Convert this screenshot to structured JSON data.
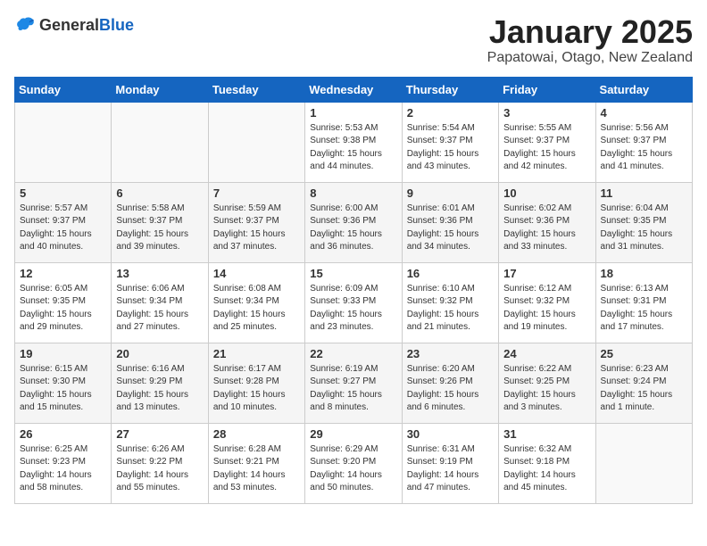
{
  "logo": {
    "general": "General",
    "blue": "Blue"
  },
  "title": "January 2025",
  "location": "Papatowai, Otago, New Zealand",
  "weekdays": [
    "Sunday",
    "Monday",
    "Tuesday",
    "Wednesday",
    "Thursday",
    "Friday",
    "Saturday"
  ],
  "weeks": [
    [
      {
        "day": "",
        "info": ""
      },
      {
        "day": "",
        "info": ""
      },
      {
        "day": "",
        "info": ""
      },
      {
        "day": "1",
        "info": "Sunrise: 5:53 AM\nSunset: 9:38 PM\nDaylight: 15 hours\nand 44 minutes."
      },
      {
        "day": "2",
        "info": "Sunrise: 5:54 AM\nSunset: 9:37 PM\nDaylight: 15 hours\nand 43 minutes."
      },
      {
        "day": "3",
        "info": "Sunrise: 5:55 AM\nSunset: 9:37 PM\nDaylight: 15 hours\nand 42 minutes."
      },
      {
        "day": "4",
        "info": "Sunrise: 5:56 AM\nSunset: 9:37 PM\nDaylight: 15 hours\nand 41 minutes."
      }
    ],
    [
      {
        "day": "5",
        "info": "Sunrise: 5:57 AM\nSunset: 9:37 PM\nDaylight: 15 hours\nand 40 minutes."
      },
      {
        "day": "6",
        "info": "Sunrise: 5:58 AM\nSunset: 9:37 PM\nDaylight: 15 hours\nand 39 minutes."
      },
      {
        "day": "7",
        "info": "Sunrise: 5:59 AM\nSunset: 9:37 PM\nDaylight: 15 hours\nand 37 minutes."
      },
      {
        "day": "8",
        "info": "Sunrise: 6:00 AM\nSunset: 9:36 PM\nDaylight: 15 hours\nand 36 minutes."
      },
      {
        "day": "9",
        "info": "Sunrise: 6:01 AM\nSunset: 9:36 PM\nDaylight: 15 hours\nand 34 minutes."
      },
      {
        "day": "10",
        "info": "Sunrise: 6:02 AM\nSunset: 9:36 PM\nDaylight: 15 hours\nand 33 minutes."
      },
      {
        "day": "11",
        "info": "Sunrise: 6:04 AM\nSunset: 9:35 PM\nDaylight: 15 hours\nand 31 minutes."
      }
    ],
    [
      {
        "day": "12",
        "info": "Sunrise: 6:05 AM\nSunset: 9:35 PM\nDaylight: 15 hours\nand 29 minutes."
      },
      {
        "day": "13",
        "info": "Sunrise: 6:06 AM\nSunset: 9:34 PM\nDaylight: 15 hours\nand 27 minutes."
      },
      {
        "day": "14",
        "info": "Sunrise: 6:08 AM\nSunset: 9:34 PM\nDaylight: 15 hours\nand 25 minutes."
      },
      {
        "day": "15",
        "info": "Sunrise: 6:09 AM\nSunset: 9:33 PM\nDaylight: 15 hours\nand 23 minutes."
      },
      {
        "day": "16",
        "info": "Sunrise: 6:10 AM\nSunset: 9:32 PM\nDaylight: 15 hours\nand 21 minutes."
      },
      {
        "day": "17",
        "info": "Sunrise: 6:12 AM\nSunset: 9:32 PM\nDaylight: 15 hours\nand 19 minutes."
      },
      {
        "day": "18",
        "info": "Sunrise: 6:13 AM\nSunset: 9:31 PM\nDaylight: 15 hours\nand 17 minutes."
      }
    ],
    [
      {
        "day": "19",
        "info": "Sunrise: 6:15 AM\nSunset: 9:30 PM\nDaylight: 15 hours\nand 15 minutes."
      },
      {
        "day": "20",
        "info": "Sunrise: 6:16 AM\nSunset: 9:29 PM\nDaylight: 15 hours\nand 13 minutes."
      },
      {
        "day": "21",
        "info": "Sunrise: 6:17 AM\nSunset: 9:28 PM\nDaylight: 15 hours\nand 10 minutes."
      },
      {
        "day": "22",
        "info": "Sunrise: 6:19 AM\nSunset: 9:27 PM\nDaylight: 15 hours\nand 8 minutes."
      },
      {
        "day": "23",
        "info": "Sunrise: 6:20 AM\nSunset: 9:26 PM\nDaylight: 15 hours\nand 6 minutes."
      },
      {
        "day": "24",
        "info": "Sunrise: 6:22 AM\nSunset: 9:25 PM\nDaylight: 15 hours\nand 3 minutes."
      },
      {
        "day": "25",
        "info": "Sunrise: 6:23 AM\nSunset: 9:24 PM\nDaylight: 15 hours\nand 1 minute."
      }
    ],
    [
      {
        "day": "26",
        "info": "Sunrise: 6:25 AM\nSunset: 9:23 PM\nDaylight: 14 hours\nand 58 minutes."
      },
      {
        "day": "27",
        "info": "Sunrise: 6:26 AM\nSunset: 9:22 PM\nDaylight: 14 hours\nand 55 minutes."
      },
      {
        "day": "28",
        "info": "Sunrise: 6:28 AM\nSunset: 9:21 PM\nDaylight: 14 hours\nand 53 minutes."
      },
      {
        "day": "29",
        "info": "Sunrise: 6:29 AM\nSunset: 9:20 PM\nDaylight: 14 hours\nand 50 minutes."
      },
      {
        "day": "30",
        "info": "Sunrise: 6:31 AM\nSunset: 9:19 PM\nDaylight: 14 hours\nand 47 minutes."
      },
      {
        "day": "31",
        "info": "Sunrise: 6:32 AM\nSunset: 9:18 PM\nDaylight: 14 hours\nand 45 minutes."
      },
      {
        "day": "",
        "info": ""
      }
    ]
  ]
}
